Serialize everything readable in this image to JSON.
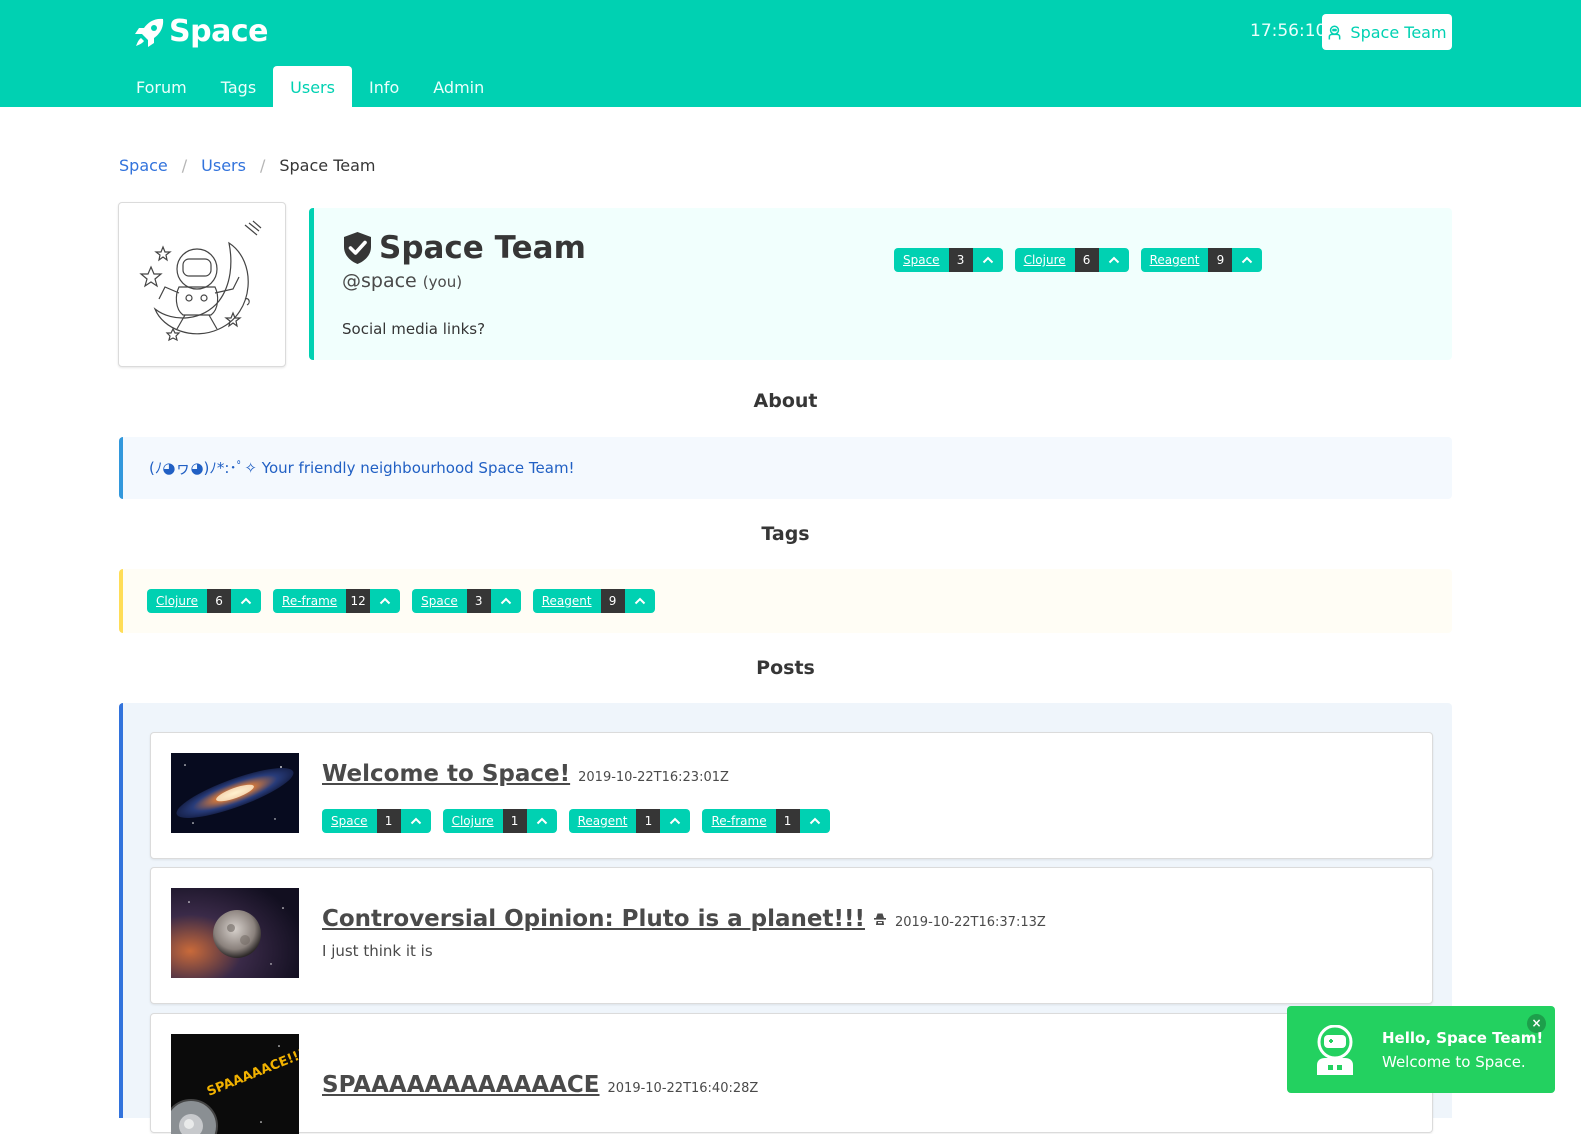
{
  "header": {
    "brand": "Space",
    "clock": "17:56:10",
    "user_button": "Space Team",
    "nav": [
      "Forum",
      "Tags",
      "Users",
      "Info",
      "Admin"
    ],
    "active_nav": "Users"
  },
  "breadcrumb": [
    "Space",
    "Users",
    "Space Team"
  ],
  "profile": {
    "name": "Space Team",
    "handle": "@space",
    "you": "(you)",
    "bio": "Social media links?",
    "tags": [
      {
        "name": "Space",
        "count": "3"
      },
      {
        "name": "Clojure",
        "count": "6"
      },
      {
        "name": "Reagent",
        "count": "9"
      }
    ]
  },
  "sections": {
    "about_title": "About",
    "about_text": "(ﾉ◕ヮ◕)ﾉ*:･ﾟ✧ Your friendly neighbourhood Space Team!",
    "tags_title": "Tags",
    "posts_title": "Posts"
  },
  "user_tags": [
    {
      "name": "Clojure",
      "count": "6"
    },
    {
      "name": "Re-frame",
      "count": "12"
    },
    {
      "name": "Space",
      "count": "3"
    },
    {
      "name": "Reagent",
      "count": "9"
    }
  ],
  "posts": [
    {
      "title": "Welcome to Space!",
      "date": "2019-10-22T16:23:01Z",
      "tags": [
        {
          "name": "Space",
          "count": "1"
        },
        {
          "name": "Clojure",
          "count": "1"
        },
        {
          "name": "Reagent",
          "count": "1"
        },
        {
          "name": "Re-frame",
          "count": "1"
        }
      ]
    },
    {
      "title": "Controversial Opinion: Pluto is a planet!!!",
      "date": "2019-10-22T16:37:13Z",
      "snippet": "I just think it is"
    },
    {
      "title": "SPAAAAAAAAAAAACE",
      "date": "2019-10-22T16:40:28Z",
      "thumb_text": "SPAAAAACE!!!!"
    }
  ],
  "toast": {
    "title": "Hello, Space Team!",
    "message": "Welcome to Space.",
    "close": "×"
  },
  "colors": {
    "primary": "#00d1b2",
    "link": "#3273dc",
    "info": "#3298dc",
    "warning": "#ffdd57",
    "success": "#23d160",
    "dark": "#363636"
  }
}
